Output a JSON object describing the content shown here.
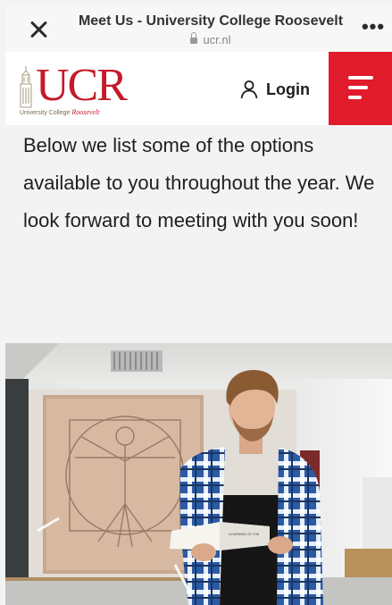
{
  "browser": {
    "page_title": "Meet Us - University College Roosevelt",
    "url": "ucr.nl",
    "close_icon": "close-icon",
    "more_icon": "more-icon"
  },
  "header": {
    "logo_text": "UCR",
    "logo_subtitle_prefix": "University College",
    "logo_subtitle_accent": "Roosevelt",
    "login_label": "Login",
    "login_icon": "person-icon",
    "menu_icon": "hamburger-menu-icon",
    "brand_color": "#e01b2b"
  },
  "content": {
    "intro_text": "Below we list some of the options available to you throughout the year. We look forward to meeting with you soon!"
  },
  "photo": {
    "book_title": "Learning is the only thing the mind never exhausts"
  }
}
